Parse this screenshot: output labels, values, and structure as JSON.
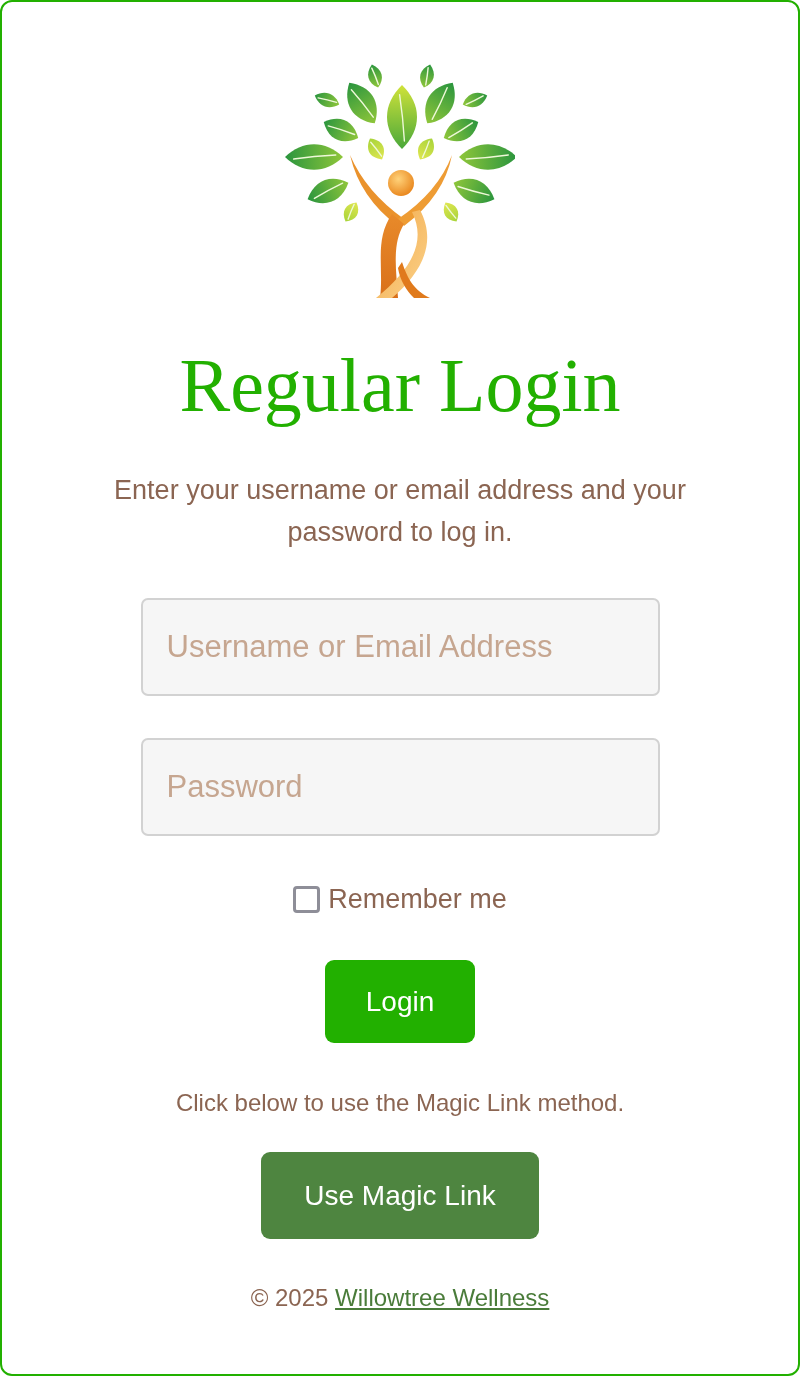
{
  "title": "Regular Login",
  "intro": "Enter your username or email address and your password to log in.",
  "username_field": {
    "placeholder": "Username or Email Address"
  },
  "password_field": {
    "placeholder": "Password"
  },
  "remember": {
    "label": "Remember me",
    "checked": false
  },
  "login_button": "Login",
  "magic_text": "Click below to use the Magic Link method.",
  "magic_button": "Use Magic Link",
  "footer": {
    "copyright": "© 2025",
    "link": "Willowtree Wellness"
  }
}
